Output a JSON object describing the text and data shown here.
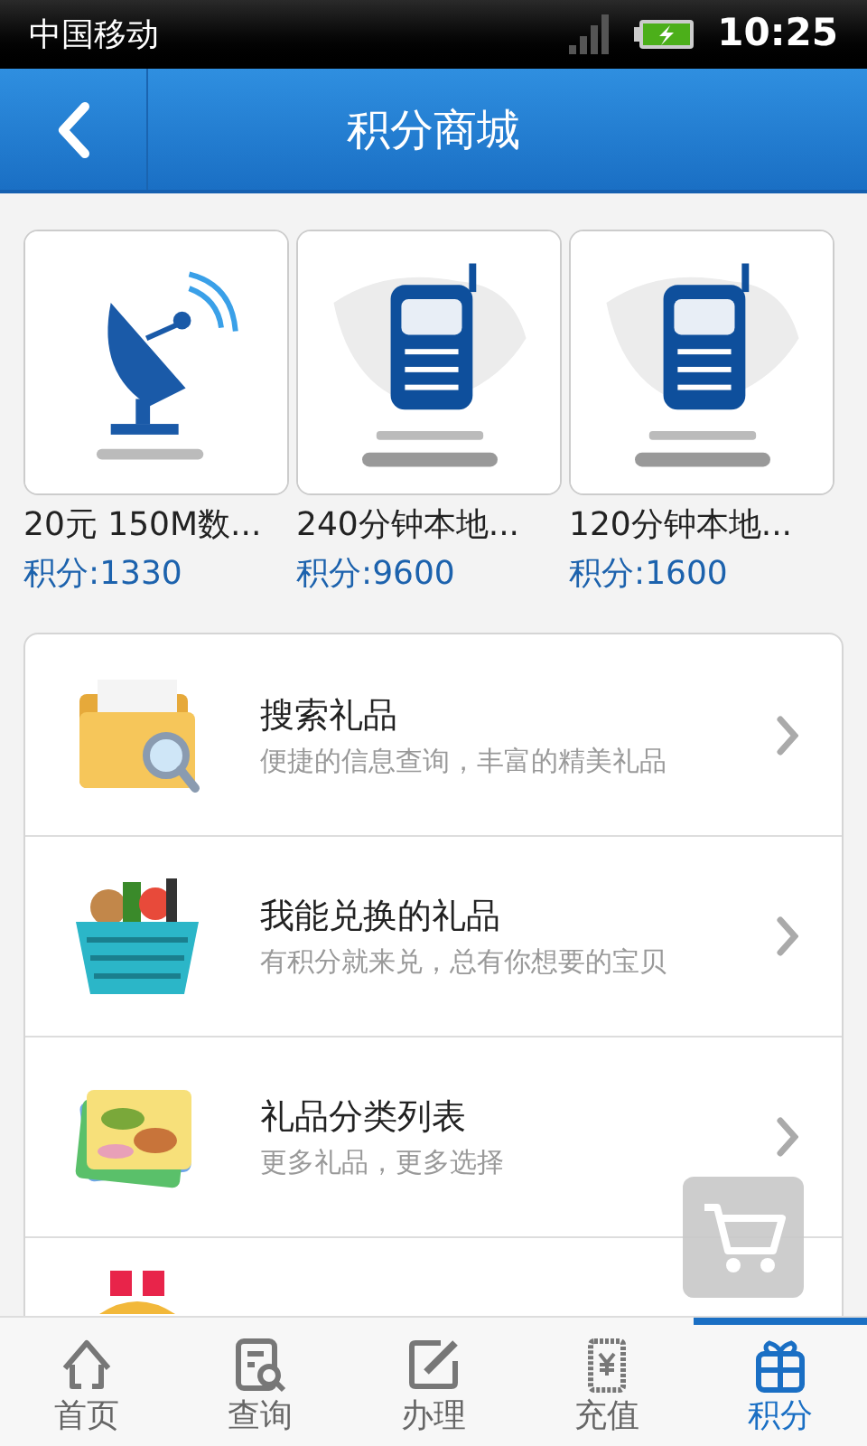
{
  "status_bar": {
    "carrier": "中国移动",
    "time": "10:25"
  },
  "header": {
    "title": "积分商城"
  },
  "products": [
    {
      "kind": "data",
      "name": "20元 150M数...",
      "points": "积分:1330"
    },
    {
      "kind": "phone",
      "name": "240分钟本地...",
      "points": "积分:9600"
    },
    {
      "kind": "phone",
      "name": "120分钟本地...",
      "points": "积分:1600"
    }
  ],
  "menu": [
    {
      "kind": "search",
      "title": "搜索礼品",
      "subtitle": "便捷的信息查询，丰富的精美礼品"
    },
    {
      "kind": "basket",
      "title": "我能兑换的礼品",
      "subtitle": "有积分就来兑，总有你想要的宝贝"
    },
    {
      "kind": "cards",
      "title": "礼品分类列表",
      "subtitle": "更多礼品，更多选择"
    },
    {
      "kind": "medal"
    }
  ],
  "tabs": [
    {
      "kind": "home",
      "label": "首页",
      "selected": false
    },
    {
      "kind": "query",
      "label": "查询",
      "selected": false
    },
    {
      "kind": "handle",
      "label": "办理",
      "selected": false
    },
    {
      "kind": "recharge",
      "label": "充值",
      "selected": false
    },
    {
      "kind": "gift",
      "label": "积分",
      "selected": true
    }
  ]
}
